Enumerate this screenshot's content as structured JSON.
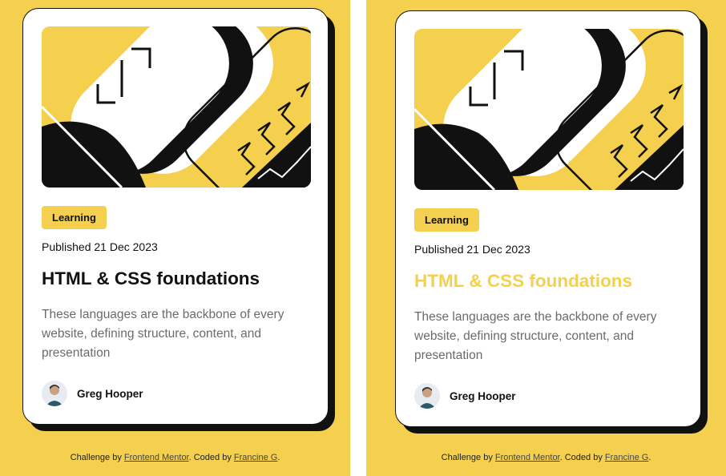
{
  "cards": [
    {
      "badge": "Learning",
      "published": "Published 21 Dec 2023",
      "title": "HTML & CSS foundations",
      "description": "These languages are the backbone of every website, defining structure, content, and presentation",
      "author": "Greg Hooper"
    },
    {
      "badge": "Learning",
      "published": "Published 21 Dec 2023",
      "title": "HTML & CSS foundations",
      "description": "These languages are the backbone of every website, defining structure, content, and presentation",
      "author": "Greg Hooper"
    }
  ],
  "attribution": {
    "prefix": "Challenge by",
    "challenge_link": "Frontend Mentor",
    "middle": ". Coded by",
    "coder_link": "Francine G",
    "suffix": "."
  },
  "colors": {
    "background": "#f4d04e",
    "card": "#ffffff",
    "ink": "#111111",
    "muted": "#6b6b6b",
    "title_hover": "#f4d04e"
  }
}
